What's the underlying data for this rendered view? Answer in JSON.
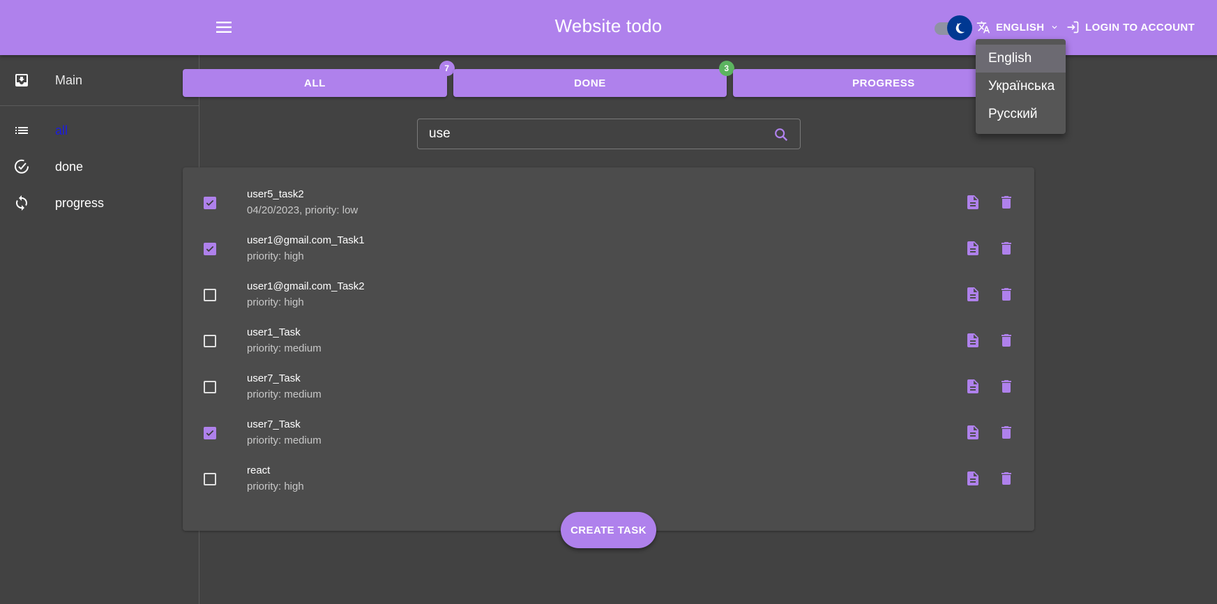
{
  "app": {
    "title": "Website todo",
    "accent_color": "#af81ec",
    "background_color": "#424242"
  },
  "header": {
    "menu_icon": "menu-icon",
    "theme_toggle": {
      "mode": "dark",
      "icon": "moon-icon"
    },
    "language_button": {
      "label": "ENGLISH",
      "icon": "translate-icon",
      "caret_icon": "chevron-down-icon"
    },
    "login_button": {
      "label": "LOGIN TO ACCOUNT",
      "icon": "login-icon"
    }
  },
  "language_menu": {
    "open": true,
    "selected": "English",
    "options": [
      "English",
      "Українська",
      "Русский"
    ]
  },
  "sidebar": {
    "header_item": {
      "label": "Main",
      "icon": "inbox-icon"
    },
    "items": [
      {
        "label": "all",
        "icon": "list-icon",
        "active": true,
        "color": "#1b1be0"
      },
      {
        "label": "done",
        "icon": "check-circle-icon",
        "active": false
      },
      {
        "label": "progress",
        "icon": "sync-icon",
        "active": false
      }
    ]
  },
  "tabs": [
    {
      "label": "ALL",
      "badge": "7",
      "badge_color": "#af81ec"
    },
    {
      "label": "DONE",
      "badge": "3",
      "badge_color": "#5cb460"
    },
    {
      "label": "PROGRESS",
      "badge": "",
      "badge_color": ""
    }
  ],
  "search": {
    "value": "use",
    "placeholder": "",
    "icon": "search-icon"
  },
  "tasks": [
    {
      "title": "user5_task2",
      "subtitle": "04/20/2023, priority: low",
      "done": true
    },
    {
      "title": "user1@gmail.com_Task1",
      "subtitle": "priority: high",
      "done": true
    },
    {
      "title": "user1@gmail.com_Task2",
      "subtitle": "priority: high",
      "done": false
    },
    {
      "title": "user1_Task",
      "subtitle": "priority: medium",
      "done": false
    },
    {
      "title": "user7_Task",
      "subtitle": "priority: medium",
      "done": false
    },
    {
      "title": "user7_Task",
      "subtitle": "priority: medium",
      "done": true
    },
    {
      "title": "react",
      "subtitle": "priority: high",
      "done": false
    }
  ],
  "task_actions": {
    "edit_icon": "document-icon",
    "delete_icon": "trash-icon"
  },
  "create_button": {
    "label": "CREATE TASK"
  }
}
